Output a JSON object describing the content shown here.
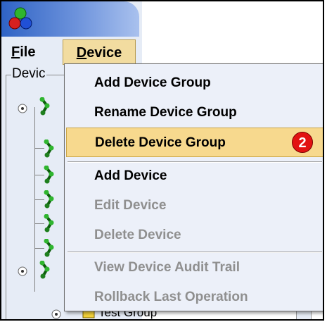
{
  "menubar": {
    "file": {
      "first": "F",
      "rest": "ile"
    },
    "device": {
      "first": "D",
      "rest": "evice"
    }
  },
  "panel": {
    "group_label": "Devic"
  },
  "tree": {
    "bottom_item_label": "Test Group"
  },
  "device_menu": {
    "items": [
      {
        "label": "Add Device Group",
        "state": "enabled"
      },
      {
        "label": "Rename Device Group",
        "state": "enabled"
      },
      {
        "label": "Delete Device Group",
        "state": "selected",
        "callout": "2"
      },
      {
        "label": "Add Device",
        "state": "enabled"
      },
      {
        "label": "Edit Device",
        "state": "disabled"
      },
      {
        "label": "Delete Device",
        "state": "disabled"
      },
      {
        "label": "View Device Audit Trail",
        "state": "disabled"
      },
      {
        "label": "Rollback Last Operation",
        "state": "disabled"
      }
    ]
  },
  "colors": {
    "menu_highlight": "#f7d98e",
    "callout_red": "#e21212",
    "disabled_text": "#8f8f8f",
    "app_background": "#e6ecf6"
  },
  "icons": [
    "app-logo-icon",
    "device-group-icon",
    "tree-toggle-icon",
    "folder-icon"
  ]
}
